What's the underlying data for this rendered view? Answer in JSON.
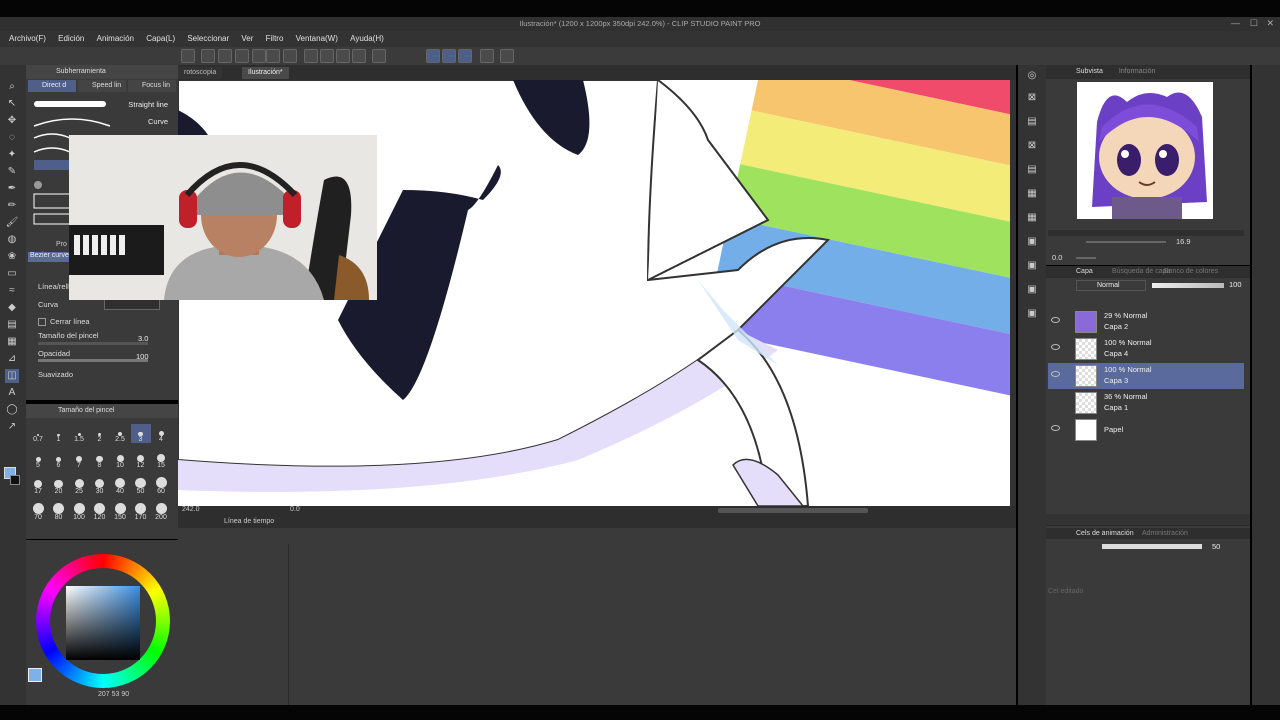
{
  "window": {
    "title": "Ilustración* (1200 x 1200px 350dpi 242.0%) - CLIP STUDIO PAINT PRO"
  },
  "menu": [
    "Archivo(F)",
    "Edición",
    "Animación",
    "Capa(L)",
    "Seleccionar",
    "Ver",
    "Filtro",
    "Ventana(W)",
    "Ayuda(H)"
  ],
  "tabs": [
    "rotoscopia",
    "Ilustración*"
  ],
  "subtool": {
    "header": "Subherramienta",
    "tabs": [
      "Direct d",
      "Speed lin",
      "Focus lin"
    ],
    "brushes": [
      "Straight line",
      "Curve"
    ]
  },
  "tool_property": {
    "header": "Pro",
    "bezier_label": "Bezier curve",
    "line_label": "Línea/rell",
    "curve_label": "Curva",
    "close_line": "Cerrar línea",
    "brush_size_label": "Tamaño del pincel",
    "brush_size_value": "3.0",
    "opacity_label": "Opacidad",
    "opacity_value": "100",
    "smoothing_label": "Suavizado"
  },
  "brush_size_panel": {
    "header": "Tamaño del pincel",
    "sizes": [
      "0.7",
      "1",
      "1.5",
      "2",
      "2.5",
      "3",
      "4",
      "5",
      "6",
      "7",
      "8",
      "10",
      "12",
      "15",
      "17",
      "20",
      "25",
      "30",
      "40",
      "50",
      "60",
      "70",
      "80",
      "100",
      "120",
      "150",
      "170",
      "200"
    ]
  },
  "color": {
    "hue_value": "207",
    "sat_value": "53",
    "bri_value": "90",
    "current": "#7fb0e8"
  },
  "canvas": {
    "zoom": "242.0",
    "angle": "0.0"
  },
  "timeline": {
    "header": "Línea de tiempo"
  },
  "subview": {
    "header": "Subvista",
    "tab2": "Información",
    "zoom": "16.9",
    "angle": "0.0"
  },
  "layer_panel": {
    "tabs": [
      "Capa",
      "Búsqueda de capa",
      "Banco de colores"
    ],
    "blend_mode": "Normal",
    "opacity": "100",
    "layers": [
      {
        "opacity_mode": "29 % Normal",
        "name": "Capa 2",
        "visible": true,
        "selected": false
      },
      {
        "opacity_mode": "100 % Normal",
        "name": "Capa 4",
        "visible": true,
        "selected": false
      },
      {
        "opacity_mode": "100 % Normal",
        "name": "Capa 3",
        "visible": true,
        "selected": true
      },
      {
        "opacity_mode": "36 % Normal",
        "name": "Capa 1",
        "visible": false,
        "selected": false
      },
      {
        "opacity_mode": "",
        "name": "Papel",
        "visible": true,
        "selected": false
      }
    ]
  },
  "animation_cels": {
    "header": "Cels de animación",
    "tab2": "Administración",
    "opacity": "50",
    "status": "Cel editado"
  },
  "colors": {
    "accent": "#5b6fa8",
    "selected_layer": "#5a6a9c"
  }
}
